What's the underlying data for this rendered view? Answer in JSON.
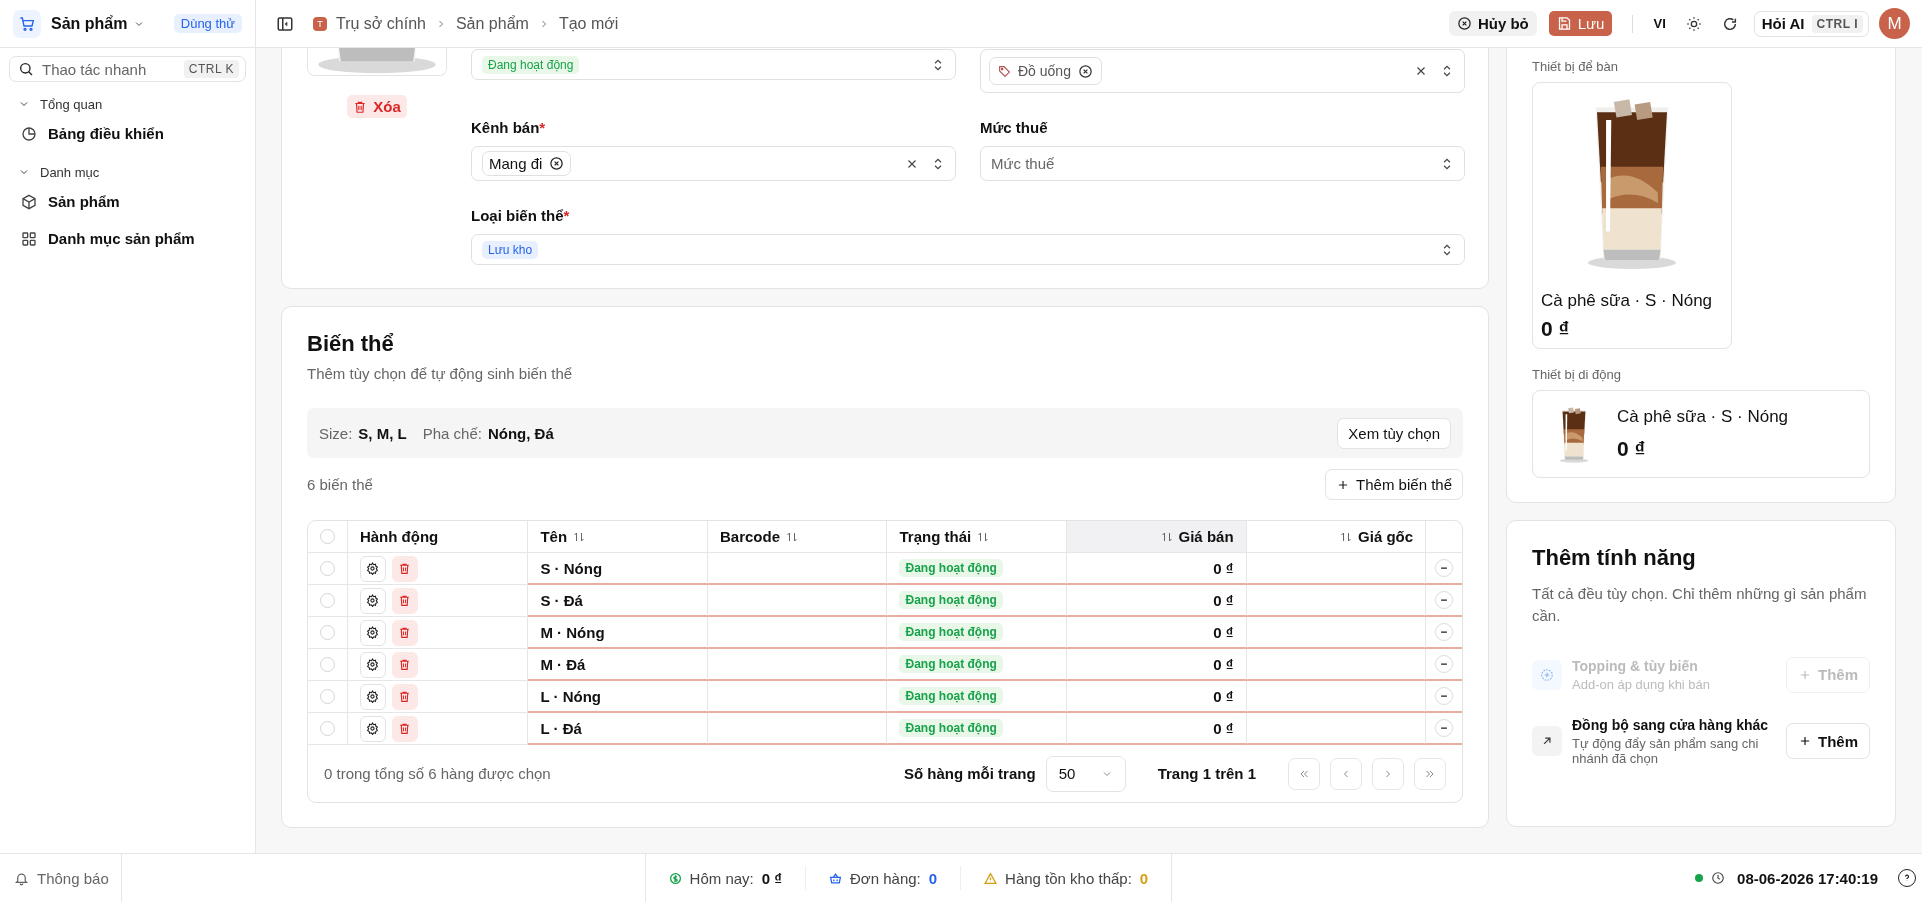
{
  "app": {
    "title": "Sản phẩm",
    "badge": "Dùng thử"
  },
  "breadcrumb": {
    "avatar": "T",
    "items": [
      "Trụ sở chính",
      "Sản phẩm",
      "Tạo mới"
    ]
  },
  "header_actions": {
    "cancel": "Hủy bỏ",
    "save": "Lưu",
    "language": "VI",
    "ask_ai": "Hỏi AI",
    "ask_ai_shortcut": "CTRL I",
    "user_avatar": "M"
  },
  "sidebar": {
    "search": {
      "placeholder": "Thao tác nhanh",
      "shortcut": "CTRL K"
    },
    "groups": [
      {
        "label": "Tổng quan",
        "expanded": true,
        "items": [
          {
            "label": "Bảng điều khiển",
            "selected": false
          }
        ]
      },
      {
        "label": "Danh mục",
        "expanded": true,
        "items": [
          {
            "label": "Sản phẩm",
            "selected": false
          },
          {
            "label": "Danh mục sản phẩm",
            "selected": false
          }
        ]
      }
    ]
  },
  "form": {
    "delete_button": "Xóa",
    "status": {
      "value": "Đang hoạt động"
    },
    "category": {
      "tags": [
        "Đồ uống"
      ]
    },
    "sales_channel": {
      "label": "Kênh bán",
      "required_mark": "*",
      "tags": [
        "Mang đi"
      ]
    },
    "tax_rate": {
      "label": "Mức thuế",
      "placeholder": "Mức thuế"
    },
    "variant_type": {
      "label": "Loại biến thể",
      "required_mark": "*",
      "value": "Lưu kho"
    }
  },
  "variants": {
    "title": "Biến thể",
    "subtitle": "Thêm tùy chọn để tự động sinh biến thể",
    "options": [
      {
        "name": "Size:",
        "values": "S, M, L"
      },
      {
        "name": "Pha chế:",
        "values": "Nóng, Đá"
      }
    ],
    "view_options": "Xem tùy chọn",
    "count": "6 biến thể",
    "add_button": "Thêm biến thể",
    "table": {
      "all_checked": false,
      "columns": [
        {
          "label": "Hành động",
          "sortable": false,
          "highlighted": false
        },
        {
          "label": "Tên",
          "sortable": true,
          "highlighted": false
        },
        {
          "label": "Barcode",
          "sortable": true,
          "highlighted": false
        },
        {
          "label": "Trạng thái",
          "sortable": true,
          "highlighted": false
        },
        {
          "label": "Giá bán",
          "sortable": true,
          "highlighted": true
        },
        {
          "label": "Giá gốc",
          "sortable": true,
          "highlighted": false
        }
      ],
      "rows": [
        {
          "name": "S · Nóng",
          "status": "Đang hoạt động",
          "price": "0 ₫",
          "selected": false
        },
        {
          "name": "S · Đá",
          "status": "Đang hoạt động",
          "price": "0 ₫",
          "selected": false
        },
        {
          "name": "M · Nóng",
          "status": "Đang hoạt động",
          "price": "0 ₫",
          "selected": false
        },
        {
          "name": "M · Đá",
          "status": "Đang hoạt động",
          "price": "0 ₫",
          "selected": false
        },
        {
          "name": "L · Nóng",
          "status": "Đang hoạt động",
          "price": "0 ₫",
          "selected": false
        },
        {
          "name": "L · Đá",
          "status": "Đang hoạt động",
          "price": "0 ₫",
          "selected": false
        }
      ]
    },
    "footer": {
      "selection": "0 trong tổng số 6 hàng được chọn",
      "rows_per_page_label": "Số hàng mỗi trang",
      "rows_per_page": "50",
      "page": "Trang 1 trên 1"
    }
  },
  "preview": {
    "desktop": {
      "label": "Thiết bị để bàn",
      "name": "Cà phê sữa · S · Nóng",
      "price": "0 ₫"
    },
    "mobile": {
      "label": "Thiết bị di động",
      "name": "Cà phê sữa · S · Nóng",
      "price": "0 ₫"
    }
  },
  "features": {
    "title": "Thêm tính năng",
    "description": "Tất cả đều tùy chọn. Chỉ thêm những gì sản phẩm cần.",
    "items": [
      {
        "title": "Topping & tùy biến",
        "subtitle": "Add-on áp dụng khi bán",
        "button": "Thêm",
        "disabled": true
      },
      {
        "title": "Đồng bộ sang cửa hàng khác",
        "subtitle": "Tự động đẩy sản phẩm sang chi nhánh đã chọn",
        "button": "Thêm",
        "disabled": false
      }
    ]
  },
  "status_bar": {
    "notifications": "Thông báo",
    "stats": [
      {
        "label": "Hôm nay:",
        "value": "0 ₫",
        "color": "#111111"
      },
      {
        "label": "Đơn hàng:",
        "value": "0",
        "color": "#2563eb"
      },
      {
        "label": "Hàng tồn kho thấp:",
        "value": "0",
        "color": "#d4a017"
      }
    ],
    "online": true,
    "datetime": "08-06-2026 17:40:19"
  }
}
